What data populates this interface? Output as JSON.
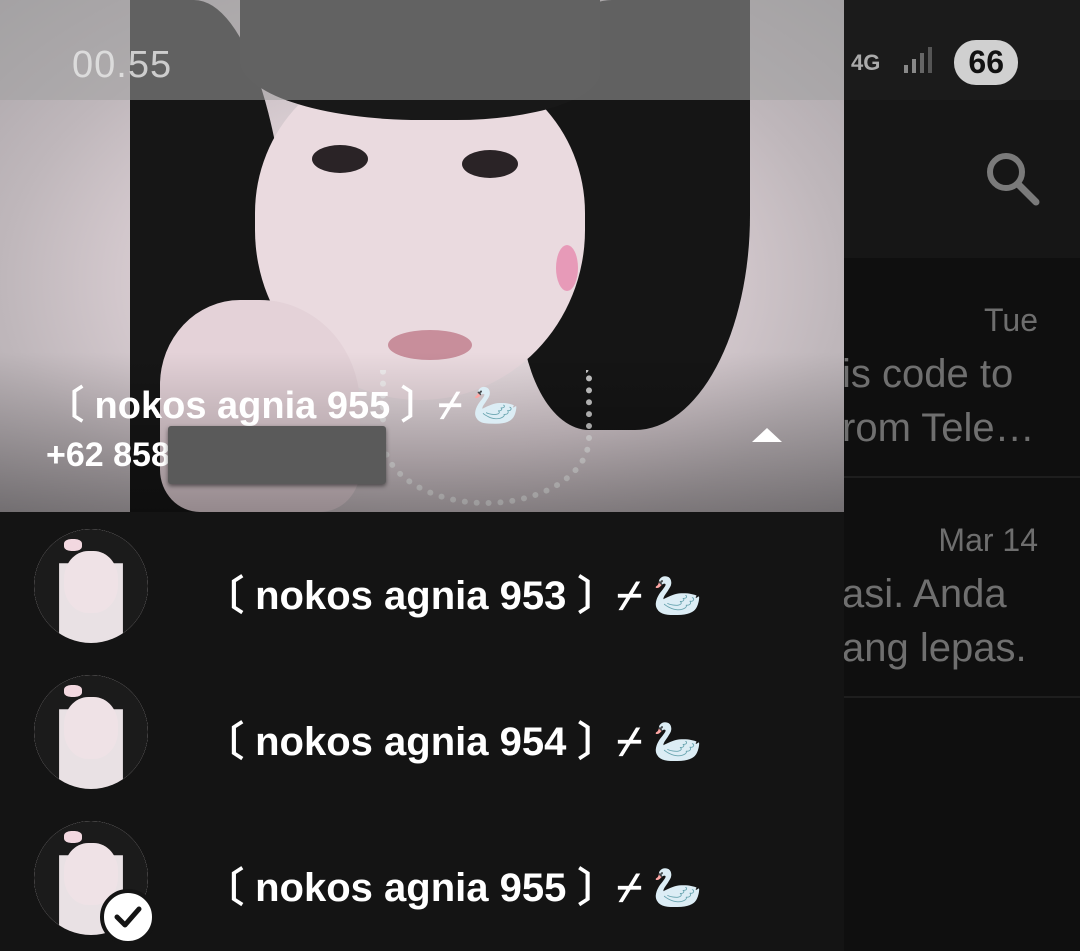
{
  "status_bar": {
    "time": "00.55",
    "network": "4G",
    "battery": "66"
  },
  "chat_list": {
    "chats": [
      {
        "date": "Tue",
        "preview_line1": "is code to",
        "preview_line2": "rom Tele…"
      },
      {
        "date": "Mar 14",
        "preview_line1": "asi. Anda",
        "preview_line2": "ang lepas."
      }
    ]
  },
  "drawer": {
    "current_account": {
      "name": "〔 nokos agnia 955 〕⌿ 🦢",
      "phone": "+62 858"
    },
    "accounts": [
      {
        "name": "〔 nokos agnia 953 〕⌿ 🦢",
        "selected": false
      },
      {
        "name": "〔 nokos agnia 954 〕⌿ 🦢",
        "selected": false
      },
      {
        "name": "〔 nokos agnia 955 〕⌿ 🦢",
        "selected": true
      }
    ]
  },
  "icons": {
    "search": "search-icon",
    "expand": "chevron-up-icon",
    "check": "check-icon",
    "mute": "mute-icon",
    "signal": "signal-icon"
  }
}
